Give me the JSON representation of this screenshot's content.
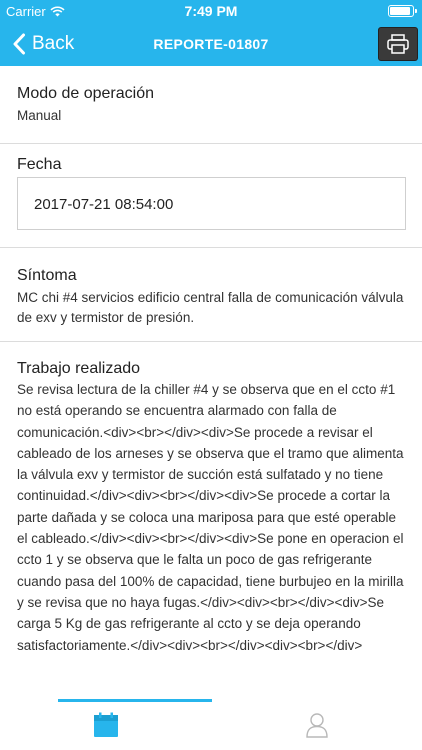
{
  "status_bar": {
    "carrier": "Carrier",
    "time": "7:49 PM"
  },
  "nav": {
    "back_label": "Back",
    "title": "REPORTE-01807"
  },
  "sections": {
    "modo": {
      "title": "Modo de operación",
      "value": "Manual"
    },
    "fecha": {
      "title": "Fecha",
      "value": "2017-07-21 08:54:00"
    },
    "sintoma": {
      "title": "Síntoma",
      "value": "MC chi #4 servicios edificio central falla de comunicación válvula de exv y termistor de presión."
    },
    "trabajo": {
      "title": "Trabajo realizado",
      "value": "Se revisa lectura de la chiller #4 y se observa que en el ccto #1 no está operando se encuentra alarmado con falla de comunicación.<div><br></div><div>Se procede a revisar el cableado de los arneses y se observa que el tramo que alimenta la válvula exv y termistor de succión está sulfatado y no tiene continuidad.</div><div><br></div><div>Se procede a cortar la parte dañada y se coloca una mariposa para que esté operable el cableado.</div><div><br></div><div>Se pone en operacion el ccto 1 y se observa que le falta un poco de gas refrigerante cuando pasa del 100% de capacidad, tiene burbujeo en la mirilla y se revisa que no haya fugas.</div><div><br></div><div>Se carga 5 Kg de gas refrigerante al ccto y se deja operando satisfactoriamente.</div><div><br></div><div><br></div>"
    }
  },
  "tabs": [
    {
      "icon": "calendar-icon",
      "active": true
    },
    {
      "icon": "user-icon",
      "active": false
    }
  ],
  "colors": {
    "accent": "#27b5ec",
    "print_button": "#3a3a3a",
    "inactive_icon": "#b8b8b8"
  }
}
